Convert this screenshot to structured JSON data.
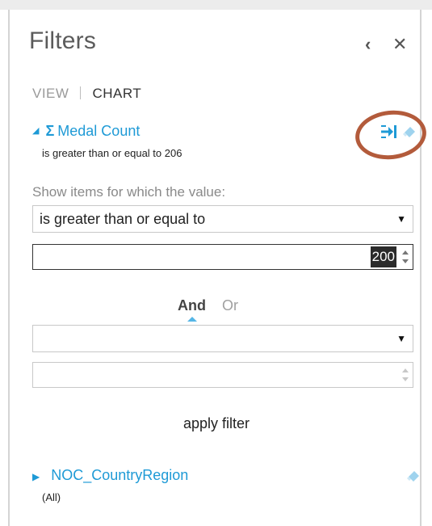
{
  "panel": {
    "title": "Filters",
    "icons": {
      "back": "chevron-left-icon",
      "close": "close-icon"
    },
    "back_glyph": "‹",
    "close_glyph": "✕"
  },
  "tabs": {
    "view": "VIEW",
    "chart": "CHART",
    "active": "CHART"
  },
  "filters": [
    {
      "field_name": "Medal Count",
      "aggregate_glyph": "Σ",
      "expanded": true,
      "summary": "is greater than or equal to 206",
      "prompt": "Show items for which the value:",
      "condition1": {
        "operator": "is greater than or equal to",
        "value": "200"
      },
      "logic": {
        "and_label": "And",
        "or_label": "Or",
        "selected": "And"
      },
      "condition2": {
        "operator": "",
        "value": ""
      },
      "apply_label": "apply filter"
    },
    {
      "field_name": "NOC_CountryRegion",
      "expanded": false,
      "summary": "(All)"
    }
  ],
  "colors": {
    "accent": "#1e9ad6",
    "highlight_ring": "#b35b3b",
    "title": "#5b5b5b"
  }
}
